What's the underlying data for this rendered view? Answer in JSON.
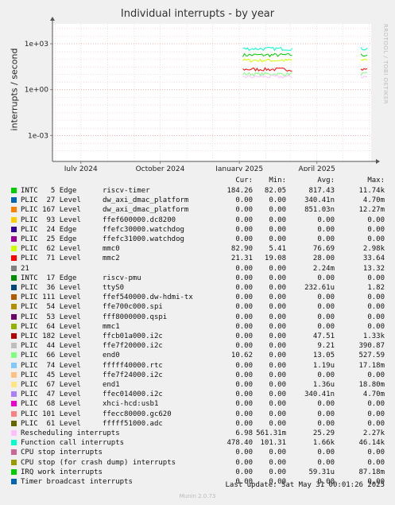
{
  "chart_data": {
    "type": "line",
    "title": "Individual interrupts - by year",
    "ylabel": "interrupts / second",
    "yscale": "log",
    "ylim": [
      2e-05,
      20000
    ],
    "ytick_labels": [
      "1e+03",
      "1e+00",
      "1e-03"
    ],
    "ytick_values": [
      1000,
      1,
      0.001
    ],
    "xlim": [
      "2024-05-29",
      "2025-06-03"
    ],
    "xtick_labels": [
      "July 2024",
      "October 2024",
      "January 2025",
      "April 2025"
    ],
    "xtick_values": [
      "2024-07-01",
      "2024-10-01",
      "2025-01-01",
      "2025-04-01"
    ],
    "grid": true,
    "legend_columns": [
      "Cur:",
      "Min:",
      "Avg:",
      "Max:"
    ],
    "data_segments": [
      {
        "start": "2025-01-05",
        "end": "2025-03-05"
      },
      {
        "start": "2025-05-22",
        "end": "2025-05-31"
      }
    ],
    "series": [
      {
        "name": "INTC   5 Edge      riscv-timer",
        "color": "#00cc00",
        "cur": "184.26",
        "min": "82.05",
        "avg": "817.43",
        "max": "11.74k",
        "level": 184.26
      },
      {
        "name": "PLIC  27 Level     dw_axi_dmac_platform",
        "color": "#0066b3",
        "cur": "0.00",
        "min": "0.00",
        "avg": "340.41n",
        "max": "4.70m",
        "level": 0
      },
      {
        "name": "PLIC 167 Level     dw_axi_dmac_platform",
        "color": "#ff8000",
        "cur": "0.00",
        "min": "0.00",
        "avg": "851.03n",
        "max": "12.27m",
        "level": 0
      },
      {
        "name": "PLIC  93 Level     ffef600000.dc8200",
        "color": "#ffcc00",
        "cur": "0.00",
        "min": "0.00",
        "avg": "0.00",
        "max": "0.00",
        "level": 0
      },
      {
        "name": "PLIC  24 Edge      ffefc30000.watchdog",
        "color": "#330099",
        "cur": "0.00",
        "min": "0.00",
        "avg": "0.00",
        "max": "0.00",
        "level": 0
      },
      {
        "name": "PLIC  25 Edge      ffefc31000.watchdog",
        "color": "#990099",
        "cur": "0.00",
        "min": "0.00",
        "avg": "0.00",
        "max": "0.00",
        "level": 0
      },
      {
        "name": "PLIC  62 Level     mmc0",
        "color": "#ccff00",
        "cur": "82.90",
        "min": "5.41",
        "avg": "76.69",
        "max": "2.98k",
        "level": 82.9
      },
      {
        "name": "PLIC  71 Level     mmc2",
        "color": "#ff0000",
        "cur": "21.31",
        "min": "19.08",
        "avg": "28.00",
        "max": "33.64",
        "level": 21.31
      },
      {
        "name": "21",
        "color": "#808080",
        "cur": "0.00",
        "min": "0.00",
        "avg": "2.24m",
        "max": "13.32",
        "level": 0
      },
      {
        "name": "INTC  17 Edge      riscv-pmu",
        "color": "#008f00",
        "cur": "0.00",
        "min": "0.00",
        "avg": "0.00",
        "max": "0.00",
        "level": 0
      },
      {
        "name": "PLIC  36 Level     ttyS0",
        "color": "#00487d",
        "cur": "0.00",
        "min": "0.00",
        "avg": "232.61u",
        "max": "1.82",
        "level": 0
      },
      {
        "name": "PLIC 111 Level     ffef540000.dw-hdmi-tx",
        "color": "#b35a00",
        "cur": "0.00",
        "min": "0.00",
        "avg": "0.00",
        "max": "0.00",
        "level": 0
      },
      {
        "name": "PLIC  54 Level     ffe700c000.spi",
        "color": "#b38f00",
        "cur": "0.00",
        "min": "0.00",
        "avg": "0.00",
        "max": "0.00",
        "level": 0
      },
      {
        "name": "PLIC  53 Level     fff8000000.qspi",
        "color": "#6b006b",
        "cur": "0.00",
        "min": "0.00",
        "avg": "0.00",
        "max": "0.00",
        "level": 0
      },
      {
        "name": "PLIC  64 Level     mmc1",
        "color": "#8fb300",
        "cur": "0.00",
        "min": "0.00",
        "avg": "0.00",
        "max": "0.00",
        "level": 0
      },
      {
        "name": "PLIC 182 Level     ffcb01a000.i2c",
        "color": "#b30000",
        "cur": "0.00",
        "min": "0.00",
        "avg": "47.51",
        "max": "1.33k",
        "level": 0
      },
      {
        "name": "PLIC  44 Level     ffe7f20000.i2c",
        "color": "#bebebe",
        "cur": "0.00",
        "min": "0.00",
        "avg": "9.21",
        "max": "390.87",
        "level": 0
      },
      {
        "name": "PLIC  66 Level     end0",
        "color": "#80ff80",
        "cur": "10.62",
        "min": "0.00",
        "avg": "13.05",
        "max": "527.59",
        "level": 10.62
      },
      {
        "name": "PLIC  74 Level     fffff40000.rtc",
        "color": "#80c9ff",
        "cur": "0.00",
        "min": "0.00",
        "avg": "1.19u",
        "max": "17.18m",
        "level": 0
      },
      {
        "name": "PLIC  45 Level     ffe7f24000.i2c",
        "color": "#ffc080",
        "cur": "0.00",
        "min": "0.00",
        "avg": "0.00",
        "max": "0.00",
        "level": 0
      },
      {
        "name": "PLIC  67 Level     end1",
        "color": "#ffe680",
        "cur": "0.00",
        "min": "0.00",
        "avg": "1.36u",
        "max": "18.80m",
        "level": 0
      },
      {
        "name": "PLIC  47 Level     ffec014000.i2c",
        "color": "#aa80ff",
        "cur": "0.00",
        "min": "0.00",
        "avg": "340.41n",
        "max": "4.70m",
        "level": 0
      },
      {
        "name": "PLIC  68 Level     xhci-hcd:usb1",
        "color": "#ee00cc",
        "cur": "0.00",
        "min": "0.00",
        "avg": "0.00",
        "max": "0.00",
        "level": 0
      },
      {
        "name": "PLIC 101 Level     ffecc80000.gc620",
        "color": "#ff8080",
        "cur": "0.00",
        "min": "0.00",
        "avg": "0.00",
        "max": "0.00",
        "level": 0
      },
      {
        "name": "PLIC  61 Level     fffff51000.adc",
        "color": "#666600",
        "cur": "0.00",
        "min": "0.00",
        "avg": "0.00",
        "max": "0.00",
        "level": 0
      },
      {
        "name": "Rescheduling interrupts",
        "color": "#ffbfff",
        "cur": "6.98",
        "min": "561.31m",
        "avg": "25.29",
        "max": "2.27k",
        "level": 6.98
      },
      {
        "name": "Function call interrupts",
        "color": "#00ffcc",
        "cur": "478.40",
        "min": "101.31",
        "avg": "1.66k",
        "max": "46.14k",
        "level": 478.4
      },
      {
        "name": "CPU stop interrupts",
        "color": "#cc6699",
        "cur": "0.00",
        "min": "0.00",
        "avg": "0.00",
        "max": "0.00",
        "level": 0
      },
      {
        "name": "CPU stop (for crash dump) interrupts",
        "color": "#999900",
        "cur": "0.00",
        "min": "0.00",
        "avg": "0.00",
        "max": "0.00",
        "level": 0
      },
      {
        "name": "IRQ work interrupts",
        "color": "#00cc00",
        "cur": "0.00",
        "min": "0.00",
        "avg": "59.31u",
        "max": "87.18m",
        "level": 0
      },
      {
        "name": "Timer broadcast interrupts",
        "color": "#0066b3",
        "cur": "0.00",
        "min": "0.00",
        "avg": "0.00",
        "max": "0.00",
        "level": 0
      }
    ]
  },
  "side_brand": "RRDTOOL / TOBI OETIKER",
  "last_update": "Last update: Sat May 31 00:01:26 2025",
  "munin_version": "Munin 2.0.73"
}
